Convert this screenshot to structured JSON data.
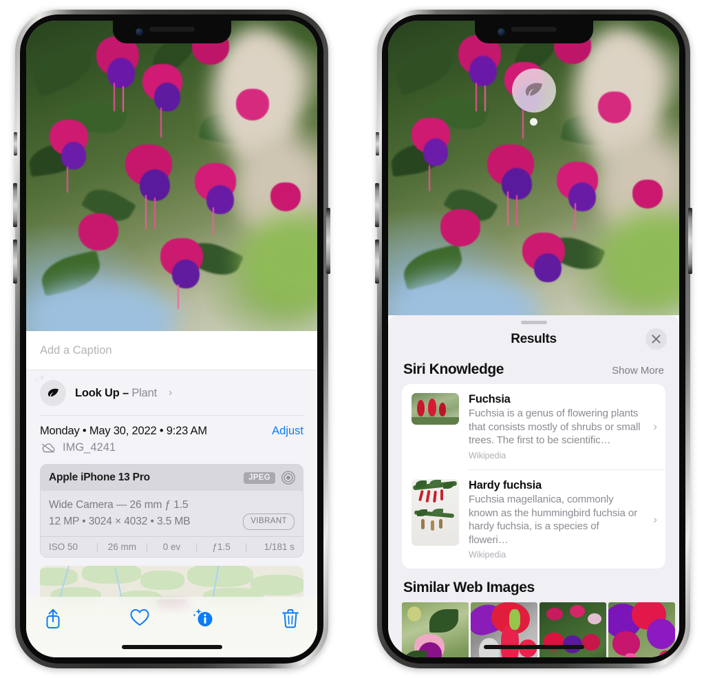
{
  "left_phone": {
    "name": "photos-detail-view",
    "caption": {
      "placeholder": "Add a Caption",
      "value": ""
    },
    "look_up": {
      "icon": "leaf-icon",
      "sparkle_icon": "sparkles-icon",
      "label": "Look Up",
      "dash": "–",
      "kind": "Plant",
      "chevron": "›"
    },
    "date_row": {
      "date": "Monday • May 30, 2022 • 9:23 AM",
      "adjust_label": "Adjust"
    },
    "file_row": {
      "icon": "cloud-slash-icon",
      "filename": "IMG_4241"
    },
    "exif": {
      "device": "Apple iPhone 13 Pro",
      "format_badge": "JPEG",
      "lens_icon": "camera-lens-icon",
      "lens_line": "Wide Camera — 26 mm ƒ 1.5",
      "specs_line": "12 MP • 3024 × 4032 • 3.5 MB",
      "quality_badge": "VIBRANT",
      "settings": [
        "ISO 50",
        "26 mm",
        "0 ev",
        "ƒ1.5",
        "1/181 s"
      ]
    },
    "map": {
      "name": "location-map-strip",
      "pin": "photo-pin"
    },
    "toolbar": [
      {
        "id": "share-button",
        "icon": "share-icon"
      },
      {
        "id": "favorite-button",
        "icon": "heart-icon"
      },
      {
        "id": "info-button",
        "icon": "info-sparkle-icon"
      },
      {
        "id": "delete-button",
        "icon": "trash-icon"
      }
    ]
  },
  "right_phone": {
    "name": "visual-lookup-results",
    "photo_badge": {
      "icon": "leaf-icon",
      "name": "visual-lookup-badge"
    },
    "sheet": {
      "title": "Results",
      "close_icon": "close-icon",
      "grabber": "sheet-grabber"
    },
    "siri_knowledge": {
      "section_title": "Siri Knowledge",
      "show_more": "Show More",
      "items": [
        {
          "title": "Fuchsia",
          "description": "Fuchsia is a genus of flowering plants that consists mostly of shrubs or small trees. The first to be scientific…",
          "source": "Wikipedia",
          "chevron": "›",
          "thumb": "fuchsia-thumbnail"
        },
        {
          "title": "Hardy fuchsia",
          "description": "Fuchsia magellanica, commonly known as the hummingbird fuchsia or hardy fuchsia, is a species of floweri…",
          "source": "Wikipedia",
          "chevron": "›",
          "thumb": "hardy-fuchsia-thumbnail"
        }
      ]
    },
    "similar_web_images": {
      "section_title": "Similar Web Images",
      "items": [
        {
          "name": "web-image-1"
        },
        {
          "name": "web-image-2"
        },
        {
          "name": "web-image-3"
        },
        {
          "name": "web-image-4"
        }
      ]
    }
  },
  "colors": {
    "accent_blue": "#0b7cf5",
    "sheet_bg": "#f0eff4",
    "card_bg": "#ffffff",
    "exif_header_bg": "#d8d7dd",
    "exif_body_bg": "#e6e5ea",
    "secondary_text": "#8a8a90"
  }
}
